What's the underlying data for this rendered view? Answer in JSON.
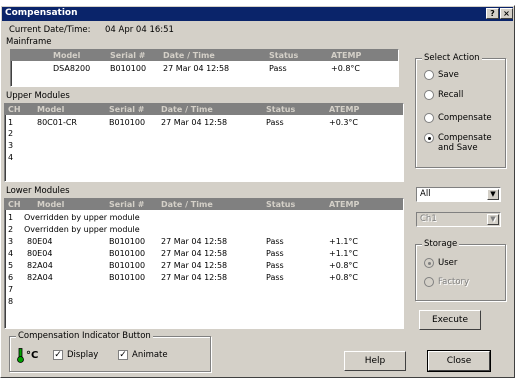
{
  "window": {
    "title": "Compensation",
    "help_btn": "?",
    "close_btn": "×"
  },
  "header": {
    "datetime_label": "Current Date/Time:",
    "datetime_value": "04 Apr 04 16:51"
  },
  "mainframe": {
    "label": "Mainframe",
    "columns": [
      "Model",
      "Serial #",
      "Date / Time",
      "Status",
      "ATEMP"
    ],
    "rows": [
      {
        "model": "DSA8200",
        "serial": "B010100",
        "datetime": "27 Mar 04 12:58",
        "status": "Pass",
        "atemp": "+0.8°C"
      }
    ]
  },
  "upper": {
    "label": "Upper Modules",
    "columns": [
      "CH",
      "Model",
      "Serial #",
      "Date / Time",
      "Status",
      "ATEMP"
    ],
    "rows": [
      {
        "ch": "1",
        "model": "80C01-CR",
        "serial": "B010100",
        "datetime": "27 Mar 04 12:58",
        "status": "Pass",
        "atemp": "+0.3°C"
      },
      {
        "ch": "2",
        "model": "",
        "serial": "",
        "datetime": "",
        "status": "",
        "atemp": ""
      },
      {
        "ch": "3",
        "model": "",
        "serial": "",
        "datetime": "",
        "status": "",
        "atemp": ""
      },
      {
        "ch": "4",
        "model": "",
        "serial": "",
        "datetime": "",
        "status": "",
        "atemp": ""
      }
    ]
  },
  "lower": {
    "label": "Lower Modules",
    "columns": [
      "CH",
      "Model",
      "Serial #",
      "Date / Time",
      "Status",
      "ATEMP"
    ],
    "rows": [
      {
        "ch": "1",
        "model": "Overridden by upper module",
        "serial": "",
        "datetime": "",
        "status": "",
        "atemp": ""
      },
      {
        "ch": "2",
        "model": "Overridden by upper module",
        "serial": "",
        "datetime": "",
        "status": "",
        "atemp": ""
      },
      {
        "ch": "3",
        "model": "80E04",
        "serial": "B010100",
        "datetime": "27 Mar 04 12:58",
        "status": "Pass",
        "atemp": "+1.1°C"
      },
      {
        "ch": "4",
        "model": "80E04",
        "serial": "B010100",
        "datetime": "27 Mar 04 12:58",
        "status": "Pass",
        "atemp": "+1.1°C"
      },
      {
        "ch": "5",
        "model": "82A04",
        "serial": "B010100",
        "datetime": "27 Mar 04 12:58",
        "status": "Pass",
        "atemp": "+0.8°C"
      },
      {
        "ch": "6",
        "model": "82A04",
        "serial": "B010100",
        "datetime": "27 Mar 04 12:58",
        "status": "Pass",
        "atemp": "+0.8°C"
      },
      {
        "ch": "7",
        "model": "",
        "serial": "",
        "datetime": "",
        "status": "",
        "atemp": ""
      },
      {
        "ch": "8",
        "model": "",
        "serial": "",
        "datetime": "",
        "status": "",
        "atemp": ""
      }
    ]
  },
  "select_action": {
    "label": "Select Action",
    "options": [
      {
        "label": "Save",
        "selected": false
      },
      {
        "label": "Recall",
        "selected": false
      },
      {
        "label": "Compensate",
        "selected": false
      },
      {
        "label": "Compensate and Save",
        "line1": "Compensate",
        "line2": "and Save",
        "selected": true
      }
    ]
  },
  "target_combo": {
    "value": "All"
  },
  "channel_combo": {
    "value": "Ch1",
    "disabled": true
  },
  "storage": {
    "label": "Storage",
    "options": [
      {
        "label": "User",
        "selected": true
      },
      {
        "label": "Factory",
        "selected": false
      }
    ]
  },
  "buttons": {
    "execute": "Execute",
    "help": "Help",
    "close": "Close"
  },
  "indicator": {
    "label": "Compensation Indicator Button",
    "icon_text": "°C",
    "display_label": "Display",
    "display_checked": true,
    "animate_label": "Animate",
    "animate_checked": true
  },
  "colors": {
    "titlebar": "#0a246a",
    "dialog_bg": "#d4d0c8",
    "header_bg": "#808080",
    "thermometer": "#00a000"
  }
}
